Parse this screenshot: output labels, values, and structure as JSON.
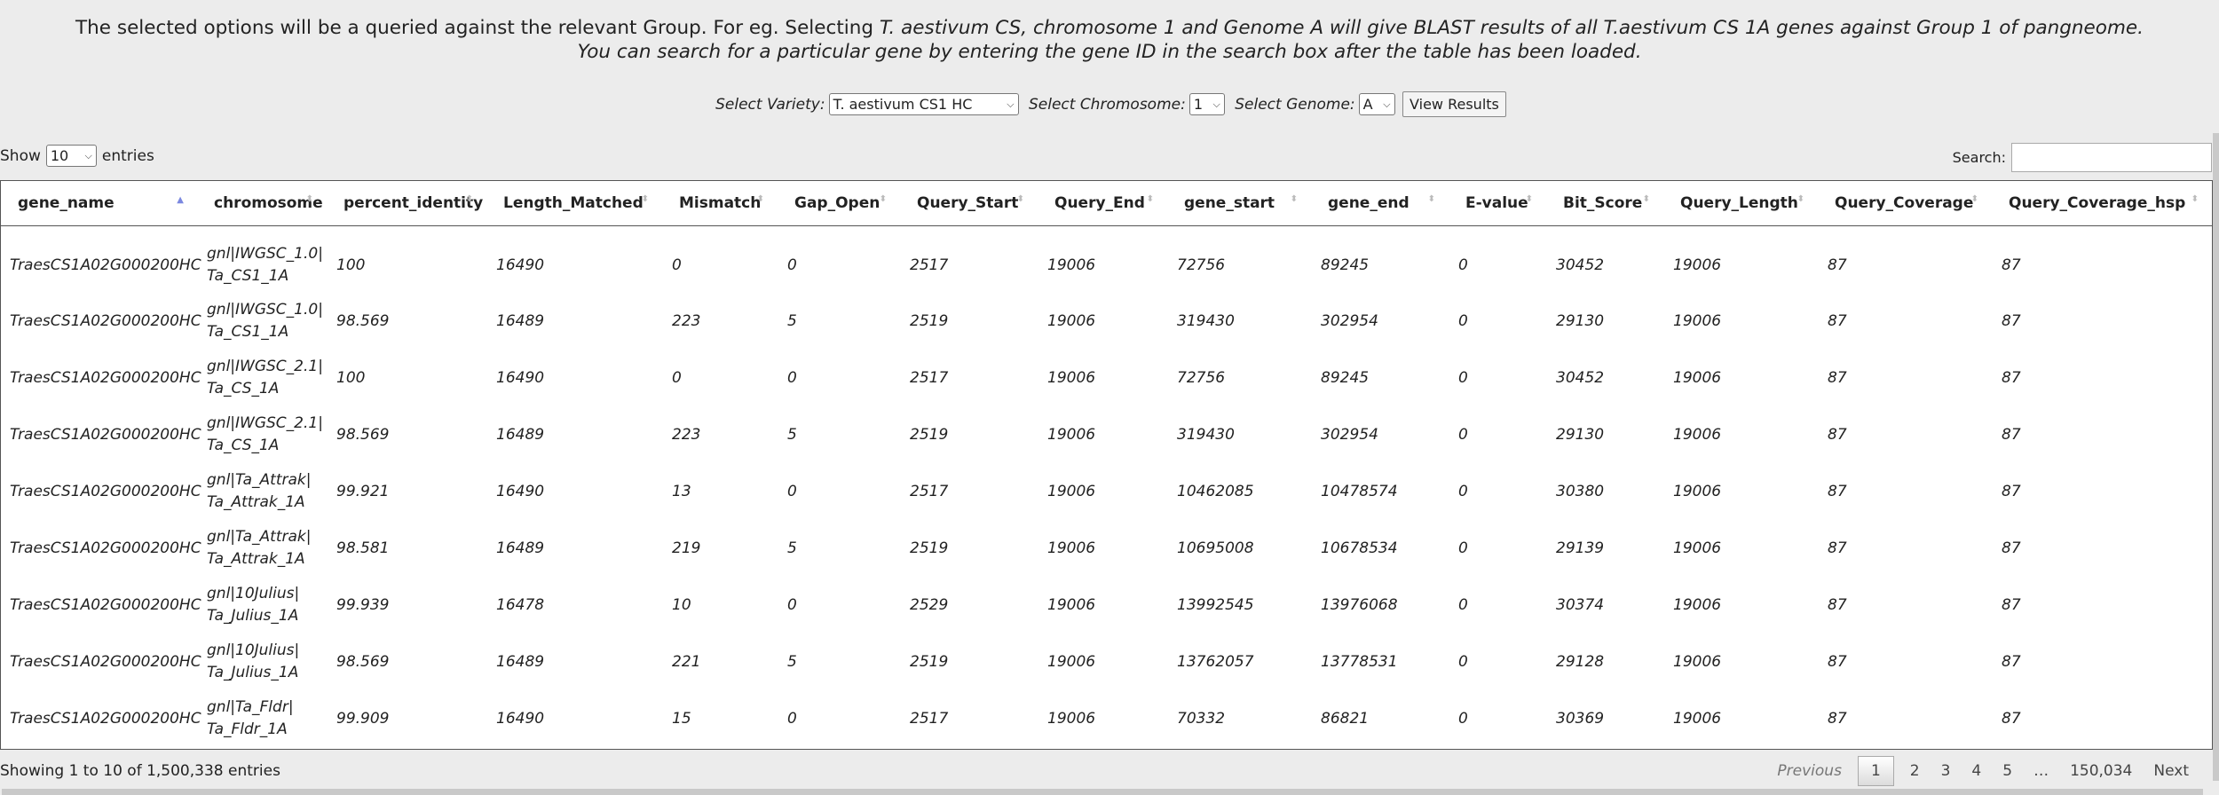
{
  "intro": {
    "line1_a": "The selected options will be a queried against the relevant Group. For eg. Selecting ",
    "line1_b": "T. aestivum CS, chromosome 1 and Genome A will give BLAST results of all T.aestivum CS 1A genes against Group 1 of pangneome.",
    "line2": "You can search for a particular gene by entering the gene ID in the search box after the table has been loaded."
  },
  "controls": {
    "variety_label": "Select Variety:",
    "variety_value": "T. aestivum CS1 HC",
    "chromosome_label": "Select Chromosome:",
    "chromosome_value": "1",
    "genome_label": "Select Genome:",
    "genome_value": "A",
    "view_button": "View Results"
  },
  "length": {
    "show": "Show",
    "value": "10",
    "entries": "entries"
  },
  "search": {
    "label": "Search:"
  },
  "columns": [
    "gene_name",
    "chromosome",
    "percent_identity",
    "Length_Matched",
    "Mismatch",
    "Gap_Open",
    "Query_Start",
    "Query_End",
    "gene_start",
    "gene_end",
    "E-value",
    "Bit_Score",
    "Query_Length",
    "Query_Coverage",
    "Query_Coverage_hsp"
  ],
  "rows": [
    [
      "TraesCS1A02G000200HC",
      "gnl|IWGSC_1.0|Ta_CS1_1A",
      "100",
      "16490",
      "0",
      "0",
      "2517",
      "19006",
      "72756",
      "89245",
      "0",
      "30452",
      "19006",
      "87",
      "87"
    ],
    [
      "TraesCS1A02G000200HC",
      "gnl|IWGSC_1.0|Ta_CS1_1A",
      "98.569",
      "16489",
      "223",
      "5",
      "2519",
      "19006",
      "319430",
      "302954",
      "0",
      "29130",
      "19006",
      "87",
      "87"
    ],
    [
      "TraesCS1A02G000200HC",
      "gnl|IWGSC_2.1|Ta_CS_1A",
      "100",
      "16490",
      "0",
      "0",
      "2517",
      "19006",
      "72756",
      "89245",
      "0",
      "30452",
      "19006",
      "87",
      "87"
    ],
    [
      "TraesCS1A02G000200HC",
      "gnl|IWGSC_2.1|Ta_CS_1A",
      "98.569",
      "16489",
      "223",
      "5",
      "2519",
      "19006",
      "319430",
      "302954",
      "0",
      "29130",
      "19006",
      "87",
      "87"
    ],
    [
      "TraesCS1A02G000200HC",
      "gnl|Ta_Attrak|Ta_Attrak_1A",
      "99.921",
      "16490",
      "13",
      "0",
      "2517",
      "19006",
      "10462085",
      "10478574",
      "0",
      "30380",
      "19006",
      "87",
      "87"
    ],
    [
      "TraesCS1A02G000200HC",
      "gnl|Ta_Attrak|Ta_Attrak_1A",
      "98.581",
      "16489",
      "219",
      "5",
      "2519",
      "19006",
      "10695008",
      "10678534",
      "0",
      "29139",
      "19006",
      "87",
      "87"
    ],
    [
      "TraesCS1A02G000200HC",
      "gnl|10Julius|Ta_Julius_1A",
      "99.939",
      "16478",
      "10",
      "0",
      "2529",
      "19006",
      "13992545",
      "13976068",
      "0",
      "30374",
      "19006",
      "87",
      "87"
    ],
    [
      "TraesCS1A02G000200HC",
      "gnl|10Julius|Ta_Julius_1A",
      "98.569",
      "16489",
      "221",
      "5",
      "2519",
      "19006",
      "13762057",
      "13778531",
      "0",
      "29128",
      "19006",
      "87",
      "87"
    ],
    [
      "TraesCS1A02G000200HC",
      "gnl|Ta_Fldr|Ta_Fldr_1A",
      "99.909",
      "16490",
      "15",
      "0",
      "2517",
      "19006",
      "70332",
      "86821",
      "0",
      "30369",
      "19006",
      "87",
      "87"
    ]
  ],
  "info": "Showing 1 to 10 of 1,500,338 entries",
  "pager": {
    "previous": "Previous",
    "pages": [
      "1",
      "2",
      "3",
      "4",
      "5"
    ],
    "ellipsis": "…",
    "last": "150,034",
    "next": "Next"
  },
  "colors": {
    "sort_active": "#7b88e0",
    "border": "#555555",
    "background": "#ececec"
  },
  "icons": {
    "sort_asc": "sort-ascending-icon",
    "sort_both": "sort-icon",
    "dropdown": "chevron-down-icon"
  }
}
